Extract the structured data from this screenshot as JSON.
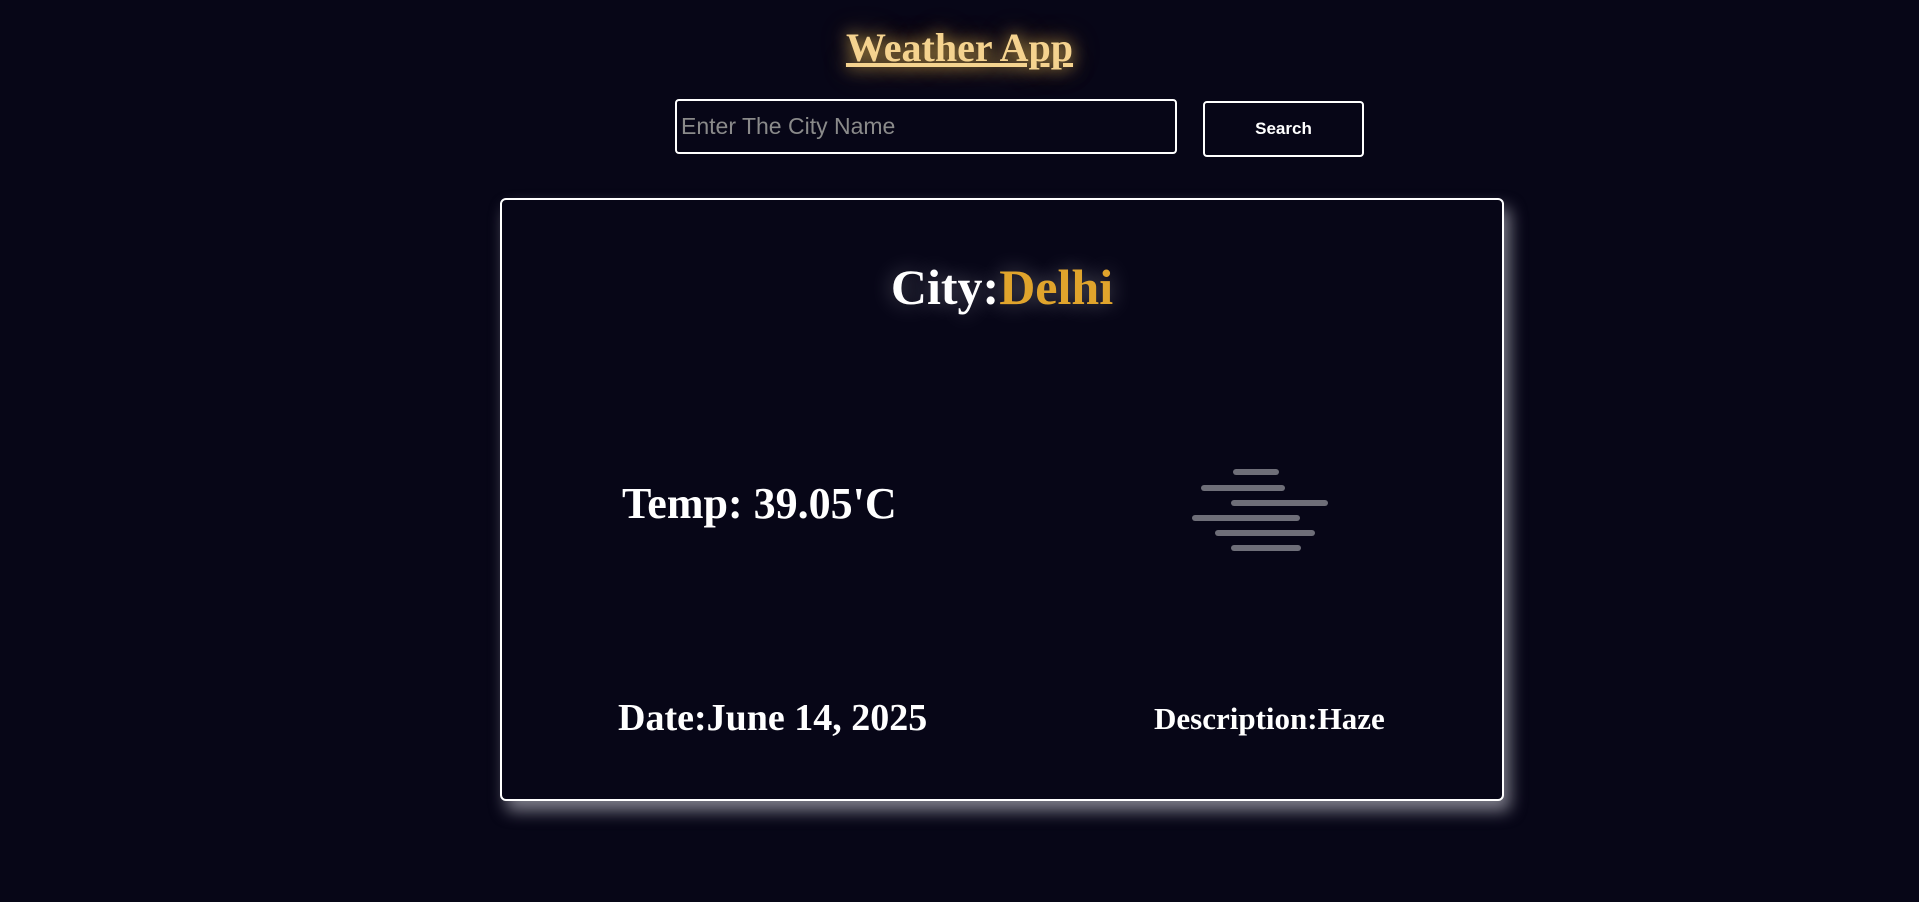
{
  "app": {
    "title": "Weather App"
  },
  "search": {
    "value": "",
    "placeholder": "Enter The City Name",
    "button_label": "Search"
  },
  "weather": {
    "city_label": "City:",
    "city": "Delhi",
    "temp_text": "Temp: 39.05'C",
    "icon": "haze-icon",
    "date_label": "Date:",
    "date": "June 14, 2025",
    "description_label": "Description:",
    "description": "Haze"
  },
  "colors": {
    "background": "#070617",
    "title": "#f5d38f",
    "city_accent": "#e0a42c",
    "text": "#ffffff",
    "border": "#ffffff"
  }
}
